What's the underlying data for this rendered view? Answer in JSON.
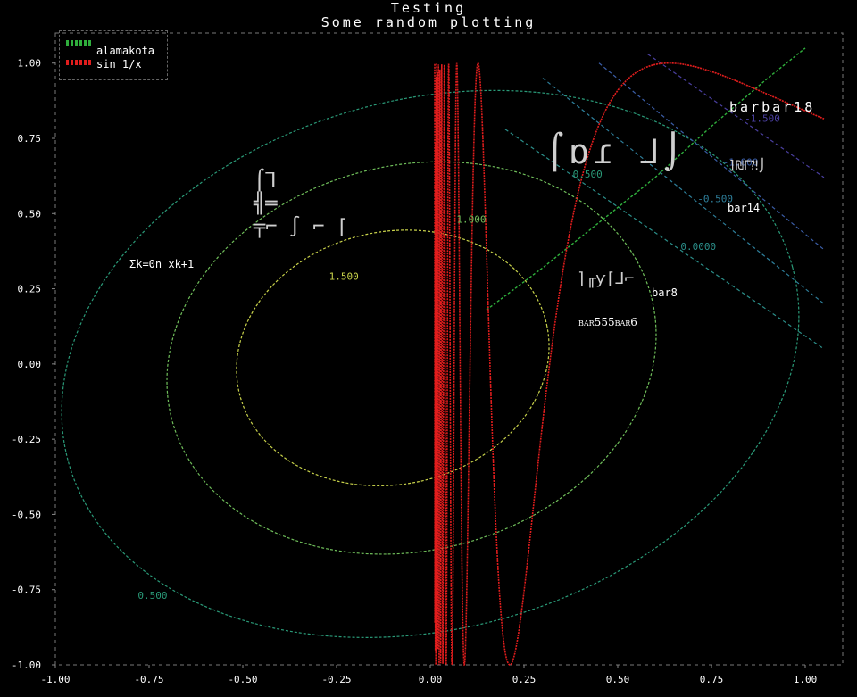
{
  "title": "Testing",
  "subtitle": "Some random plotting",
  "legend": [
    {
      "label": "alamakota",
      "color": "#2fae3c"
    },
    {
      "label": "sin 1/x",
      "color": "#e11d1d"
    }
  ],
  "annotations": {
    "sum_formula": "Σk=0n xk+1",
    "barbar18": "barbar18",
    "bar14": "bar14",
    "bar8": "bar8",
    "bar555bar6": "bar555bar6"
  },
  "chart_data": {
    "type": "line",
    "title": "Testing",
    "subtitle": "Some random plotting",
    "xlim": [
      -1.0,
      1.1
    ],
    "ylim": [
      -1.0,
      1.1
    ],
    "x_ticks": [
      -1.0,
      -0.75,
      -0.5,
      -0.25,
      0.0,
      0.25,
      0.5,
      0.75,
      1.0
    ],
    "x_tick_labels": [
      "-1.00",
      "-0.75",
      "-0.50",
      "-0.25",
      "0.00",
      "0.25",
      "0.50",
      "0.75",
      "1.00"
    ],
    "y_ticks": [
      -1.0,
      -0.75,
      -0.5,
      -0.25,
      0.0,
      0.25,
      0.5,
      0.75,
      1.0
    ],
    "y_tick_labels": [
      "-1.00",
      "-0.75",
      "-0.50",
      "-0.25",
      "0.00",
      "0.25",
      "0.50",
      "0.75",
      "1.00"
    ],
    "legend_position": "top-left",
    "series": [
      {
        "name": "alamakota",
        "color": "#2fae3c",
        "x": [
          0.15,
          0.3,
          0.45,
          0.6,
          0.75,
          0.9,
          1.0
        ],
        "y": [
          0.18,
          0.32,
          0.47,
          0.62,
          0.79,
          0.95,
          1.05
        ]
      },
      {
        "name": "sin 1/x",
        "color": "#e11d1d",
        "function": "sin(1/x)",
        "x_range": [
          0.0,
          1.05
        ]
      }
    ],
    "contours": [
      {
        "level": 1.5,
        "label": "1.500",
        "color": "#c8d24a",
        "cx": -0.1,
        "cy": 0.02,
        "rx": 0.42,
        "ry": 0.42,
        "rotation": -12
      },
      {
        "level": 1.0,
        "label": "1.000",
        "color": "#6fbe5a",
        "cx": -0.05,
        "cy": 0.02,
        "rx": 0.66,
        "ry": 0.64,
        "rotation": -14
      },
      {
        "level": 0.5,
        "label": "0.500",
        "color": "#2a9a78",
        "cx": 0.0,
        "cy": 0.0,
        "rx": 1.0,
        "ry": 0.88,
        "rotation": -15
      }
    ],
    "contour_labels_extra": [
      {
        "label": "1.000",
        "x": 0.07,
        "y": 0.47,
        "color": "#6fbe5a"
      },
      {
        "label": "1.500",
        "x": -0.27,
        "y": 0.28,
        "color": "#c8d24a"
      },
      {
        "label": "0.500",
        "x": 0.38,
        "y": 0.62,
        "color": "#2a9a78"
      },
      {
        "label": "0.500",
        "x": -0.78,
        "y": -0.78,
        "color": "#2a9a78"
      }
    ],
    "diagonal_lines": [
      {
        "label": "-1.500",
        "color": "#4a3fa0",
        "x0": 0.58,
        "y0": 1.03,
        "x1": 1.05,
        "y1": 0.62
      },
      {
        "label": "-1.000",
        "color": "#3b5ea8",
        "x0": 0.45,
        "y0": 1.0,
        "x1": 1.05,
        "y1": 0.38
      },
      {
        "label": "-0.500",
        "color": "#2e7f9b",
        "x0": 0.3,
        "y0": 0.95,
        "x1": 1.05,
        "y1": 0.2
      },
      {
        "label": "0.0000",
        "color": "#2b8f8a",
        "x0": 0.2,
        "y0": 0.78,
        "x1": 1.05,
        "y1": 0.05
      }
    ]
  }
}
